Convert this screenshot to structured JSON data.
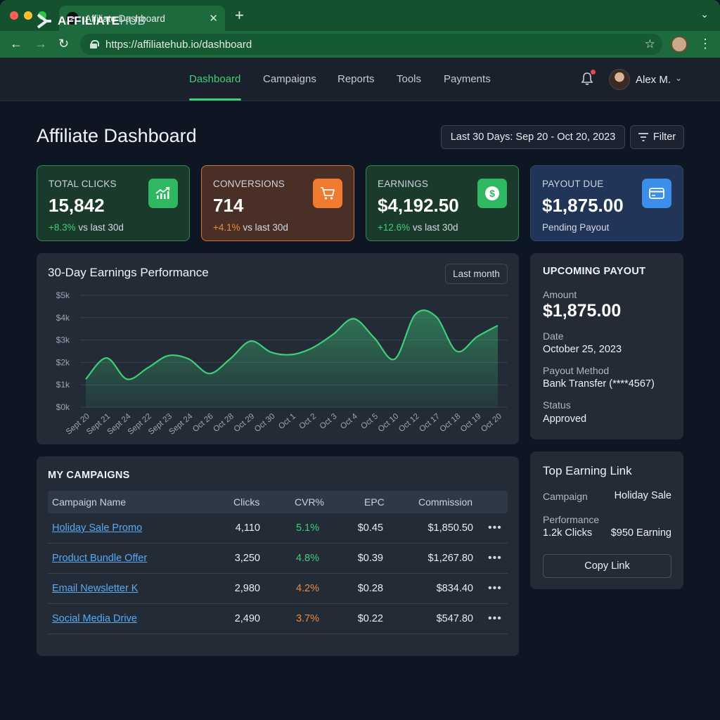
{
  "browser": {
    "tab_title": "Affiliate Dashboard",
    "url": "https://affiliatehub.io/dashboard"
  },
  "brand": {
    "name_bold": "AFFILIATE",
    "name_light": "HUB"
  },
  "nav": {
    "items": [
      {
        "label": "Dashboard",
        "active": true
      },
      {
        "label": "Campaigns"
      },
      {
        "label": "Reports"
      },
      {
        "label": "Tools"
      },
      {
        "label": "Payments"
      }
    ]
  },
  "user": {
    "name": "Alex M."
  },
  "page": {
    "title": "Affiliate Dashboard",
    "date_range": "Last 30 Days: Sep 20 - Oct 20, 2023",
    "filter_label": "Filter"
  },
  "stats": [
    {
      "label": "TOTAL CLICKS",
      "value": "15,842",
      "delta": "+8.3%",
      "delta_suffix": " vs last 30d",
      "icon": "trend-up-icon",
      "color": "#2fb862"
    },
    {
      "label": "CONVERSIONS",
      "value": "714",
      "delta": "+4.1%",
      "delta_suffix": " vs last 30d",
      "icon": "cart-icon",
      "color": "#f07a2f"
    },
    {
      "label": "EARNINGS",
      "value": "$4,192.50",
      "delta": "+12.6%",
      "delta_suffix": " vs last 30d",
      "icon": "dollar-icon",
      "color": "#2fb862"
    },
    {
      "label": "PAYOUT DUE",
      "value": "$1,875.00",
      "delta": "Pending Payout",
      "icon": "card-icon",
      "color": "#3b8eea"
    }
  ],
  "chart": {
    "title": "30-Day Earnings Performance",
    "range_button": "Last month"
  },
  "chart_data": {
    "type": "area",
    "title": "30-Day Earnings Performance",
    "categories": [
      "Sept 20",
      "Sept 21",
      "Sept 24",
      "Sept 22",
      "Sept 23",
      "Sept 24",
      "Oct 26",
      "Oct 28",
      "Oct 29",
      "Oct 30",
      "Oct 1",
      "Oct 2",
      "Oct 3",
      "Oct 4",
      "Oct 5",
      "Oct 10",
      "Oct 12",
      "Oct 17",
      "Oct 18",
      "Oct 19",
      "Oct 20"
    ],
    "x_positions": [
      0,
      1,
      2,
      3,
      4,
      5,
      6,
      7,
      8,
      9,
      10,
      11,
      12,
      13,
      14,
      15,
      16,
      17,
      18,
      19,
      20
    ],
    "values": [
      1250,
      2200,
      1250,
      1750,
      2300,
      2150,
      1500,
      2150,
      2950,
      2450,
      2350,
      2650,
      3250,
      3950,
      3100,
      2150,
      4150,
      4050,
      2500,
      3150,
      3650
    ],
    "ytick_labels": [
      "$0k",
      "$1k",
      "$2k",
      "$3k",
      "$4k",
      "$5k"
    ],
    "ylim": [
      0,
      5000
    ],
    "grid": true,
    "color": "#3ecf7a"
  },
  "payout": {
    "section_title": "UPCOMING PAYOUT",
    "amount_label": "Amount",
    "amount": "$1,875.00",
    "date_label": "Date",
    "date": "October 25, 2023",
    "method_label": "Payout Method",
    "method": "Bank Transfer (****4567)",
    "status_label": "Status",
    "status": "Approved"
  },
  "campaigns": {
    "section_title": "MY CAMPAIGNS",
    "columns": [
      "Campaign Name",
      "Clicks",
      "CVR%",
      "EPC",
      "Commission"
    ],
    "rows": [
      {
        "name": "Holiday Sale Promo",
        "clicks": "4,110",
        "cvr": "5.1%",
        "epc": "$0.45",
        "commission": "$1,850.50",
        "cvr_color": "#3ecf7a"
      },
      {
        "name": "Product Bundle Offer",
        "clicks": "3,250",
        "cvr": "4.8%",
        "epc": "$0.39",
        "commission": "$1,267.80",
        "cvr_color": "#3ecf7a"
      },
      {
        "name": "Email Newsletter K",
        "clicks": "2,980",
        "cvr": "4.2%",
        "epc": "$0.28",
        "commission": "$834.40",
        "cvr_color": "#f08a3a"
      },
      {
        "name": "Social Media Drive",
        "clicks": "2,490",
        "cvr": "3.7%",
        "epc": "$0.22",
        "commission": "$547.80",
        "cvr_color": "#f08a3a"
      }
    ],
    "row_action": "•••"
  },
  "top_link": {
    "title": "Top Earning Link",
    "campaign_label": "Campaign",
    "campaign": "Holiday Sale",
    "performance_label": "Performance",
    "clicks": "1.2k Clicks",
    "earning": "$950 Earning",
    "copy_label": "Copy Link"
  }
}
